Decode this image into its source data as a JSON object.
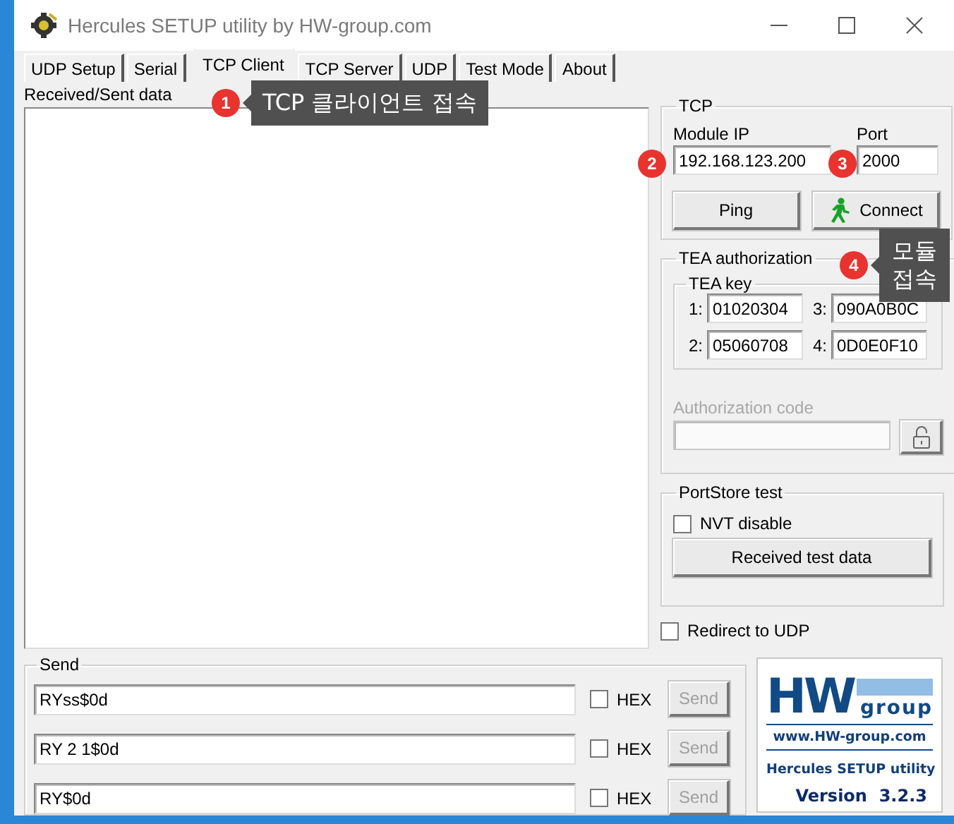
{
  "window": {
    "title": "Hercules SETUP utility by HW-group.com"
  },
  "tabs": [
    {
      "label": "UDP Setup",
      "selected": false
    },
    {
      "label": "Serial",
      "selected": false
    },
    {
      "label": "TCP Client",
      "selected": true
    },
    {
      "label": "TCP Server",
      "selected": false
    },
    {
      "label": "UDP",
      "selected": false
    },
    {
      "label": "Test Mode",
      "selected": false
    },
    {
      "label": "About",
      "selected": false
    }
  ],
  "received_sent": {
    "label": "Received/Sent data"
  },
  "tcp": {
    "title": "TCP",
    "module_ip_label": "Module IP",
    "module_ip": "192.168.123.200",
    "port_label": "Port",
    "port": "2000",
    "ping_button": "Ping",
    "connect_button": "Connect"
  },
  "tea": {
    "title": "TEA authorization",
    "key_title": "TEA key",
    "keys": [
      {
        "label": "1:",
        "value": "01020304"
      },
      {
        "label": "3:",
        "value": "090A0B0C"
      },
      {
        "label": "2:",
        "value": "05060708"
      },
      {
        "label": "4:",
        "value": "0D0E0F10"
      }
    ],
    "auth_label": "Authorization code",
    "auth_disabled": true
  },
  "portstore": {
    "title": "PortStore test",
    "nvt": {
      "label": "NVT disable",
      "checked": false
    },
    "button": "Received test data"
  },
  "redirect": {
    "label": "Redirect to UDP",
    "checked": false
  },
  "send": {
    "title": "Send",
    "rows": [
      {
        "value": "RYss$0d",
        "hex_label": "HEX",
        "hex": false,
        "button": "Send",
        "disabled": true
      },
      {
        "value": "RY 2 1$0d",
        "hex_label": "HEX",
        "hex": false,
        "button": "Send",
        "disabled": true
      },
      {
        "value": "RY$0d",
        "hex_label": "HEX",
        "hex": false,
        "button": "Send",
        "disabled": true
      }
    ]
  },
  "logo": {
    "brand": "HW",
    "brand_sub": "group",
    "site": "www.HW-group.com",
    "product": "Hercules SETUP utility",
    "version": "Version  3.2.3"
  },
  "callouts": [
    {
      "number": "1",
      "text": "TCP 클라이언트 접속"
    },
    {
      "number": "2"
    },
    {
      "number": "3"
    },
    {
      "number": "4",
      "text": "모듈 접속"
    }
  ]
}
